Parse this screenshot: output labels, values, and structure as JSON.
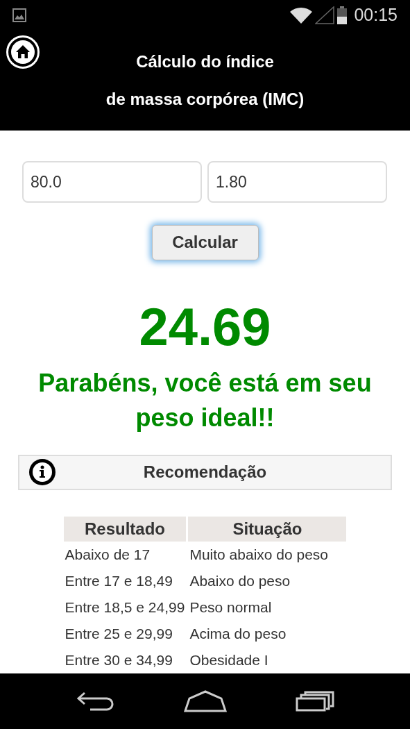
{
  "status_bar": {
    "time": "00:15"
  },
  "header": {
    "title_lines": [
      "Cálculo do índice",
      "de massa corpórea (IMC)"
    ]
  },
  "form": {
    "fields": [
      {
        "value": "80.0"
      },
      {
        "value": "1.80"
      }
    ],
    "button": {
      "label": "Calcular",
      "focused": true
    }
  },
  "result": {
    "value": "24.69",
    "message": "Parabéns, você está em seu peso ideal!!"
  },
  "panel": {
    "title": "Recomendação"
  },
  "table": {
    "columns": [
      "Resultado",
      "Situação"
    ],
    "rows": [
      [
        "Abaixo de 17",
        "Muito abaixo do peso"
      ],
      [
        "Entre 17 e 18,49",
        "Abaixo do peso"
      ],
      [
        "Entre 18,5 e 24,99",
        "Peso normal"
      ],
      [
        "Entre 25 e 29,99",
        "Acima do peso"
      ],
      [
        "Entre 30 e 34,99",
        "Obesidade I"
      ]
    ]
  }
}
